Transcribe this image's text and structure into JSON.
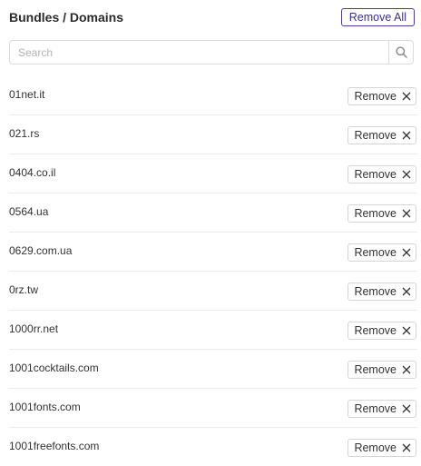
{
  "header": {
    "title": "Bundles / Domains",
    "remove_all_label": "Remove All"
  },
  "search": {
    "placeholder": "Search",
    "value": "",
    "icon": "search-icon"
  },
  "list": {
    "remove_label": "Remove",
    "remove_icon": "close-icon",
    "items": [
      {
        "domain": "01net.it"
      },
      {
        "domain": "021.rs"
      },
      {
        "domain": "0404.co.il"
      },
      {
        "domain": "0564.ua"
      },
      {
        "domain": "0629.com.ua"
      },
      {
        "domain": "0rz.tw"
      },
      {
        "domain": "1000rr.net"
      },
      {
        "domain": "1001cocktails.com"
      },
      {
        "domain": "1001fonts.com"
      },
      {
        "domain": "1001freefonts.com"
      }
    ]
  },
  "colors": {
    "accent": "#3b2f8f",
    "border": "#dcdcdc",
    "text": "#333333"
  }
}
